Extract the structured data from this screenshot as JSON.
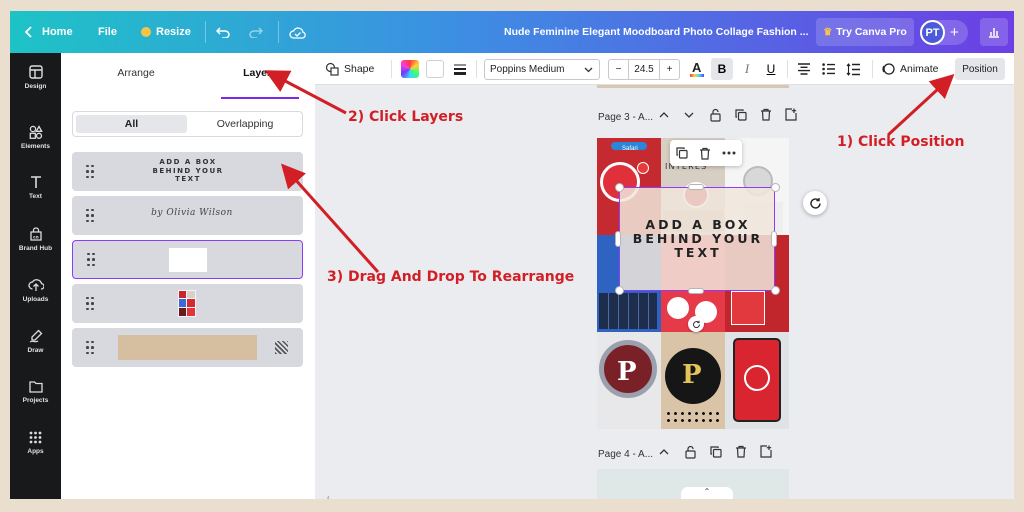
{
  "topbar": {
    "home": "Home",
    "file": "File",
    "resize": "Resize",
    "doc_title": "Nude Feminine Elegant Moodboard Photo Collage Fashion ...",
    "try_pro": "Try Canva Pro",
    "avatar_initials": "PT",
    "gradient_start": "#1ec3c6",
    "gradient_end": "#6c3fe4"
  },
  "rail": {
    "items": [
      {
        "label": "Design",
        "icon": "layout-icon"
      },
      {
        "label": "Elements",
        "icon": "elements-icon"
      },
      {
        "label": "Text",
        "icon": "text-icon"
      },
      {
        "label": "Brand Hub",
        "icon": "brand-hub-icon"
      },
      {
        "label": "Uploads",
        "icon": "upload-icon"
      },
      {
        "label": "Draw",
        "icon": "draw-icon"
      },
      {
        "label": "Projects",
        "icon": "folder-icon"
      },
      {
        "label": "Apps",
        "icon": "apps-icon"
      }
    ]
  },
  "panel": {
    "tabs": [
      "Arrange",
      "Layers"
    ],
    "active_tab": "Layers",
    "filters": [
      "All",
      "Overlapping"
    ],
    "layers": [
      {
        "type": "text",
        "text": "ADD A BOX BEHIND YOUR TEXT"
      },
      {
        "type": "script-text",
        "text": "by Olivia Wilson"
      },
      {
        "type": "white-box",
        "text": ""
      },
      {
        "type": "photo-collage",
        "text": ""
      },
      {
        "type": "background-rectangle",
        "text": ""
      }
    ]
  },
  "toolbar": {
    "shape": "Shape",
    "font": "Poppins Medium",
    "font_size": "24.5",
    "minus": "−",
    "plus": "+",
    "bold": "B",
    "italic": "I",
    "underline": "U",
    "animate": "Animate",
    "position": "Position",
    "accent": "#7d2ae8"
  },
  "canvas": {
    "page3_label": "Page 3 - A...",
    "page4_label": "Page 4 - A...",
    "selected_text": "ADD A BOX BEHIND YOUR TEXT",
    "photo_text_1": "Safari",
    "photo_text_2": "INTERES"
  },
  "annotations": {
    "step1": "1) Click Position",
    "step2": "2) Click Layers",
    "step3": "3) Drag And Drop To Rearrange",
    "color": "#d21f26"
  }
}
